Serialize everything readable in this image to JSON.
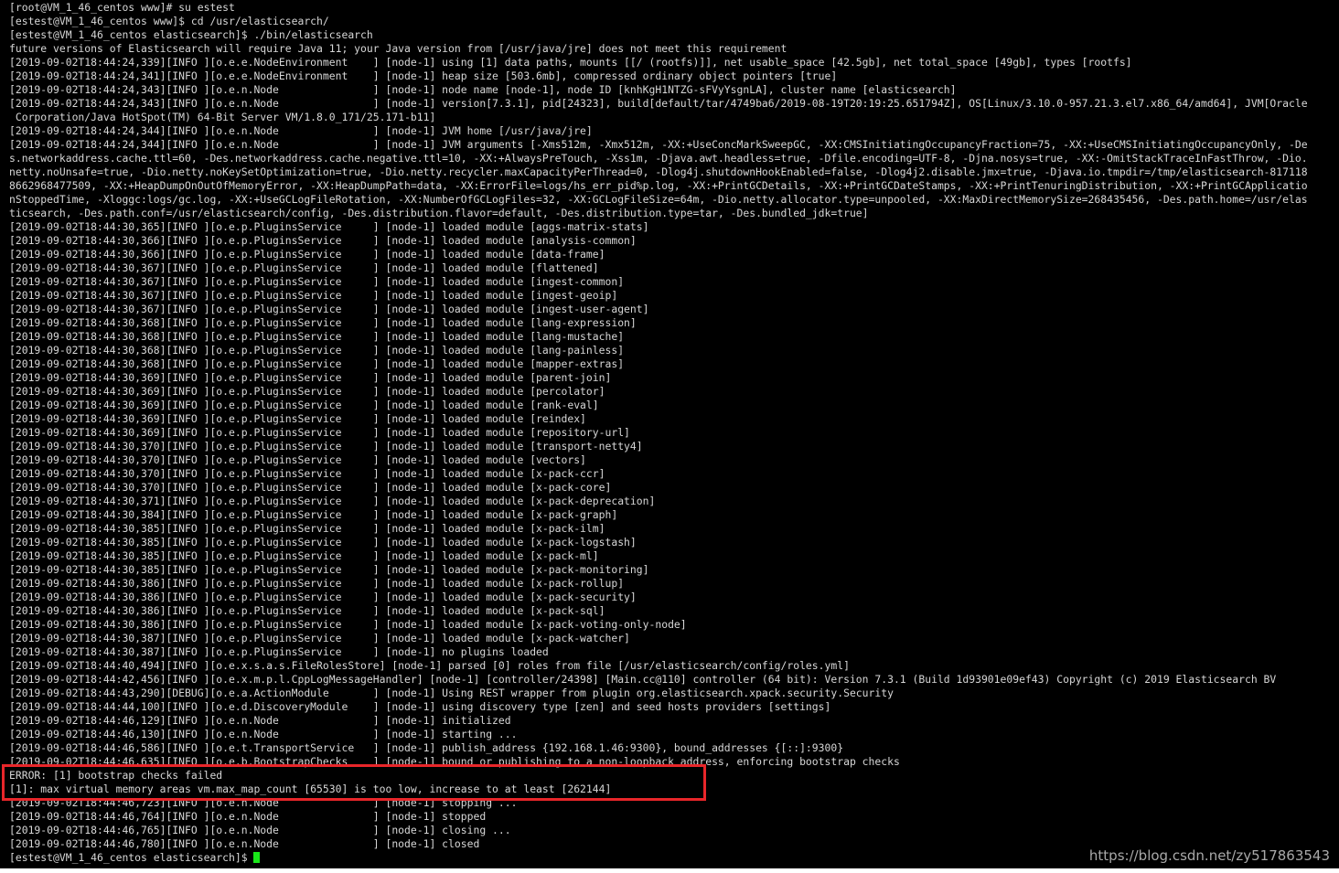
{
  "terminal": {
    "lines": [
      "[root@VM_1_46_centos www]# su estest",
      "[estest@VM_1_46_centos www]$ cd /usr/elasticsearch/",
      "[estest@VM_1_46_centos elasticsearch]$ ./bin/elasticsearch",
      "future versions of Elasticsearch will require Java 11; your Java version from [/usr/java/jre] does not meet this requirement",
      "[2019-09-02T18:44:24,339][INFO ][o.e.e.NodeEnvironment    ] [node-1] using [1] data paths, mounts [[/ (rootfs)]], net usable_space [42.5gb], net total_space [49gb], types [rootfs]",
      "[2019-09-02T18:44:24,341][INFO ][o.e.e.NodeEnvironment    ] [node-1] heap size [503.6mb], compressed ordinary object pointers [true]",
      "[2019-09-02T18:44:24,343][INFO ][o.e.n.Node               ] [node-1] node name [node-1], node ID [knhKgH1NTZG-sFVyYsgnLA], cluster name [elasticsearch]",
      "[2019-09-02T18:44:24,343][INFO ][o.e.n.Node               ] [node-1] version[7.3.1], pid[24323], build[default/tar/4749ba6/2019-08-19T20:19:25.651794Z], OS[Linux/3.10.0-957.21.3.el7.x86_64/amd64], JVM[Oracle",
      " Corporation/Java HotSpot(TM) 64-Bit Server VM/1.8.0_171/25.171-b11]",
      "[2019-09-02T18:44:24,344][INFO ][o.e.n.Node               ] [node-1] JVM home [/usr/java/jre]",
      "[2019-09-02T18:44:24,344][INFO ][o.e.n.Node               ] [node-1] JVM arguments [-Xms512m, -Xmx512m, -XX:+UseConcMarkSweepGC, -XX:CMSInitiatingOccupancyFraction=75, -XX:+UseCMSInitiatingOccupancyOnly, -De",
      "s.networkaddress.cache.ttl=60, -Des.networkaddress.cache.negative.ttl=10, -XX:+AlwaysPreTouch, -Xss1m, -Djava.awt.headless=true, -Dfile.encoding=UTF-8, -Djna.nosys=true, -XX:-OmitStackTraceInFastThrow, -Dio.",
      "netty.noUnsafe=true, -Dio.netty.noKeySetOptimization=true, -Dio.netty.recycler.maxCapacityPerThread=0, -Dlog4j.shutdownHookEnabled=false, -Dlog4j2.disable.jmx=true, -Djava.io.tmpdir=/tmp/elasticsearch-817118",
      "8662968477509, -XX:+HeapDumpOnOutOfMemoryError, -XX:HeapDumpPath=data, -XX:ErrorFile=logs/hs_err_pid%p.log, -XX:+PrintGCDetails, -XX:+PrintGCDateStamps, -XX:+PrintTenuringDistribution, -XX:+PrintGCApplicatio",
      "nStoppedTime, -Xloggc:logs/gc.log, -XX:+UseGCLogFileRotation, -XX:NumberOfGCLogFiles=32, -XX:GCLogFileSize=64m, -Dio.netty.allocator.type=unpooled, -XX:MaxDirectMemorySize=268435456, -Des.path.home=/usr/elas",
      "ticsearch, -Des.path.conf=/usr/elasticsearch/config, -Des.distribution.flavor=default, -Des.distribution.type=tar, -Des.bundled_jdk=true]",
      "[2019-09-02T18:44:30,365][INFO ][o.e.p.PluginsService     ] [node-1] loaded module [aggs-matrix-stats]",
      "[2019-09-02T18:44:30,366][INFO ][o.e.p.PluginsService     ] [node-1] loaded module [analysis-common]",
      "[2019-09-02T18:44:30,366][INFO ][o.e.p.PluginsService     ] [node-1] loaded module [data-frame]",
      "[2019-09-02T18:44:30,367][INFO ][o.e.p.PluginsService     ] [node-1] loaded module [flattened]",
      "[2019-09-02T18:44:30,367][INFO ][o.e.p.PluginsService     ] [node-1] loaded module [ingest-common]",
      "[2019-09-02T18:44:30,367][INFO ][o.e.p.PluginsService     ] [node-1] loaded module [ingest-geoip]",
      "[2019-09-02T18:44:30,367][INFO ][o.e.p.PluginsService     ] [node-1] loaded module [ingest-user-agent]",
      "[2019-09-02T18:44:30,368][INFO ][o.e.p.PluginsService     ] [node-1] loaded module [lang-expression]",
      "[2019-09-02T18:44:30,368][INFO ][o.e.p.PluginsService     ] [node-1] loaded module [lang-mustache]",
      "[2019-09-02T18:44:30,368][INFO ][o.e.p.PluginsService     ] [node-1] loaded module [lang-painless]",
      "[2019-09-02T18:44:30,368][INFO ][o.e.p.PluginsService     ] [node-1] loaded module [mapper-extras]",
      "[2019-09-02T18:44:30,369][INFO ][o.e.p.PluginsService     ] [node-1] loaded module [parent-join]",
      "[2019-09-02T18:44:30,369][INFO ][o.e.p.PluginsService     ] [node-1] loaded module [percolator]",
      "[2019-09-02T18:44:30,369][INFO ][o.e.p.PluginsService     ] [node-1] loaded module [rank-eval]",
      "[2019-09-02T18:44:30,369][INFO ][o.e.p.PluginsService     ] [node-1] loaded module [reindex]",
      "[2019-09-02T18:44:30,369][INFO ][o.e.p.PluginsService     ] [node-1] loaded module [repository-url]",
      "[2019-09-02T18:44:30,370][INFO ][o.e.p.PluginsService     ] [node-1] loaded module [transport-netty4]",
      "[2019-09-02T18:44:30,370][INFO ][o.e.p.PluginsService     ] [node-1] loaded module [vectors]",
      "[2019-09-02T18:44:30,370][INFO ][o.e.p.PluginsService     ] [node-1] loaded module [x-pack-ccr]",
      "[2019-09-02T18:44:30,370][INFO ][o.e.p.PluginsService     ] [node-1] loaded module [x-pack-core]",
      "[2019-09-02T18:44:30,371][INFO ][o.e.p.PluginsService     ] [node-1] loaded module [x-pack-deprecation]",
      "[2019-09-02T18:44:30,384][INFO ][o.e.p.PluginsService     ] [node-1] loaded module [x-pack-graph]",
      "[2019-09-02T18:44:30,385][INFO ][o.e.p.PluginsService     ] [node-1] loaded module [x-pack-ilm]",
      "[2019-09-02T18:44:30,385][INFO ][o.e.p.PluginsService     ] [node-1] loaded module [x-pack-logstash]",
      "[2019-09-02T18:44:30,385][INFO ][o.e.p.PluginsService     ] [node-1] loaded module [x-pack-ml]",
      "[2019-09-02T18:44:30,385][INFO ][o.e.p.PluginsService     ] [node-1] loaded module [x-pack-monitoring]",
      "[2019-09-02T18:44:30,386][INFO ][o.e.p.PluginsService     ] [node-1] loaded module [x-pack-rollup]",
      "[2019-09-02T18:44:30,386][INFO ][o.e.p.PluginsService     ] [node-1] loaded module [x-pack-security]",
      "[2019-09-02T18:44:30,386][INFO ][o.e.p.PluginsService     ] [node-1] loaded module [x-pack-sql]",
      "[2019-09-02T18:44:30,386][INFO ][o.e.p.PluginsService     ] [node-1] loaded module [x-pack-voting-only-node]",
      "[2019-09-02T18:44:30,387][INFO ][o.e.p.PluginsService     ] [node-1] loaded module [x-pack-watcher]",
      "[2019-09-02T18:44:30,387][INFO ][o.e.p.PluginsService     ] [node-1] no plugins loaded",
      "[2019-09-02T18:44:40,494][INFO ][o.e.x.s.a.s.FileRolesStore] [node-1] parsed [0] roles from file [/usr/elasticsearch/config/roles.yml]",
      "[2019-09-02T18:44:42,456][INFO ][o.e.x.m.p.l.CppLogMessageHandler] [node-1] [controller/24398] [Main.cc@110] controller (64 bit): Version 7.3.1 (Build 1d93901e09ef43) Copyright (c) 2019 Elasticsearch BV",
      "[2019-09-02T18:44:43,290][DEBUG][o.e.a.ActionModule       ] [node-1] Using REST wrapper from plugin org.elasticsearch.xpack.security.Security",
      "[2019-09-02T18:44:44,100][INFO ][o.e.d.DiscoveryModule    ] [node-1] using discovery type [zen] and seed hosts providers [settings]",
      "[2019-09-02T18:44:46,129][INFO ][o.e.n.Node               ] [node-1] initialized",
      "[2019-09-02T18:44:46,130][INFO ][o.e.n.Node               ] [node-1] starting ...",
      "[2019-09-02T18:44:46,586][INFO ][o.e.t.TransportService   ] [node-1] publish_address {192.168.1.46:9300}, bound_addresses {[::]:9300}",
      "[2019-09-02T18:44:46,635][INFO ][o.e.b.BootstrapChecks    ] [node-1] bound or publishing to a non-loopback address, enforcing bootstrap checks",
      "ERROR: [1] bootstrap checks failed",
      "[1]: max virtual memory areas vm.max_map_count [65530] is too low, increase to at least [262144]",
      "[2019-09-02T18:44:46,723][INFO ][o.e.n.Node               ] [node-1] stopping ...",
      "[2019-09-02T18:44:46,764][INFO ][o.e.n.Node               ] [node-1] stopped",
      "[2019-09-02T18:44:46,765][INFO ][o.e.n.Node               ] [node-1] closing ...",
      "[2019-09-02T18:44:46,780][INFO ][o.e.n.Node               ] [node-1] closed",
      "[estest@VM_1_46_centos elasticsearch]$ "
    ],
    "cursor_color": "#19e619",
    "text_color": "#d7d7d7",
    "background_color": "#000000"
  },
  "highlight": {
    "color": "#e8262a"
  },
  "watermark": {
    "text": "https://blog.csdn.net/zy517863543"
  }
}
